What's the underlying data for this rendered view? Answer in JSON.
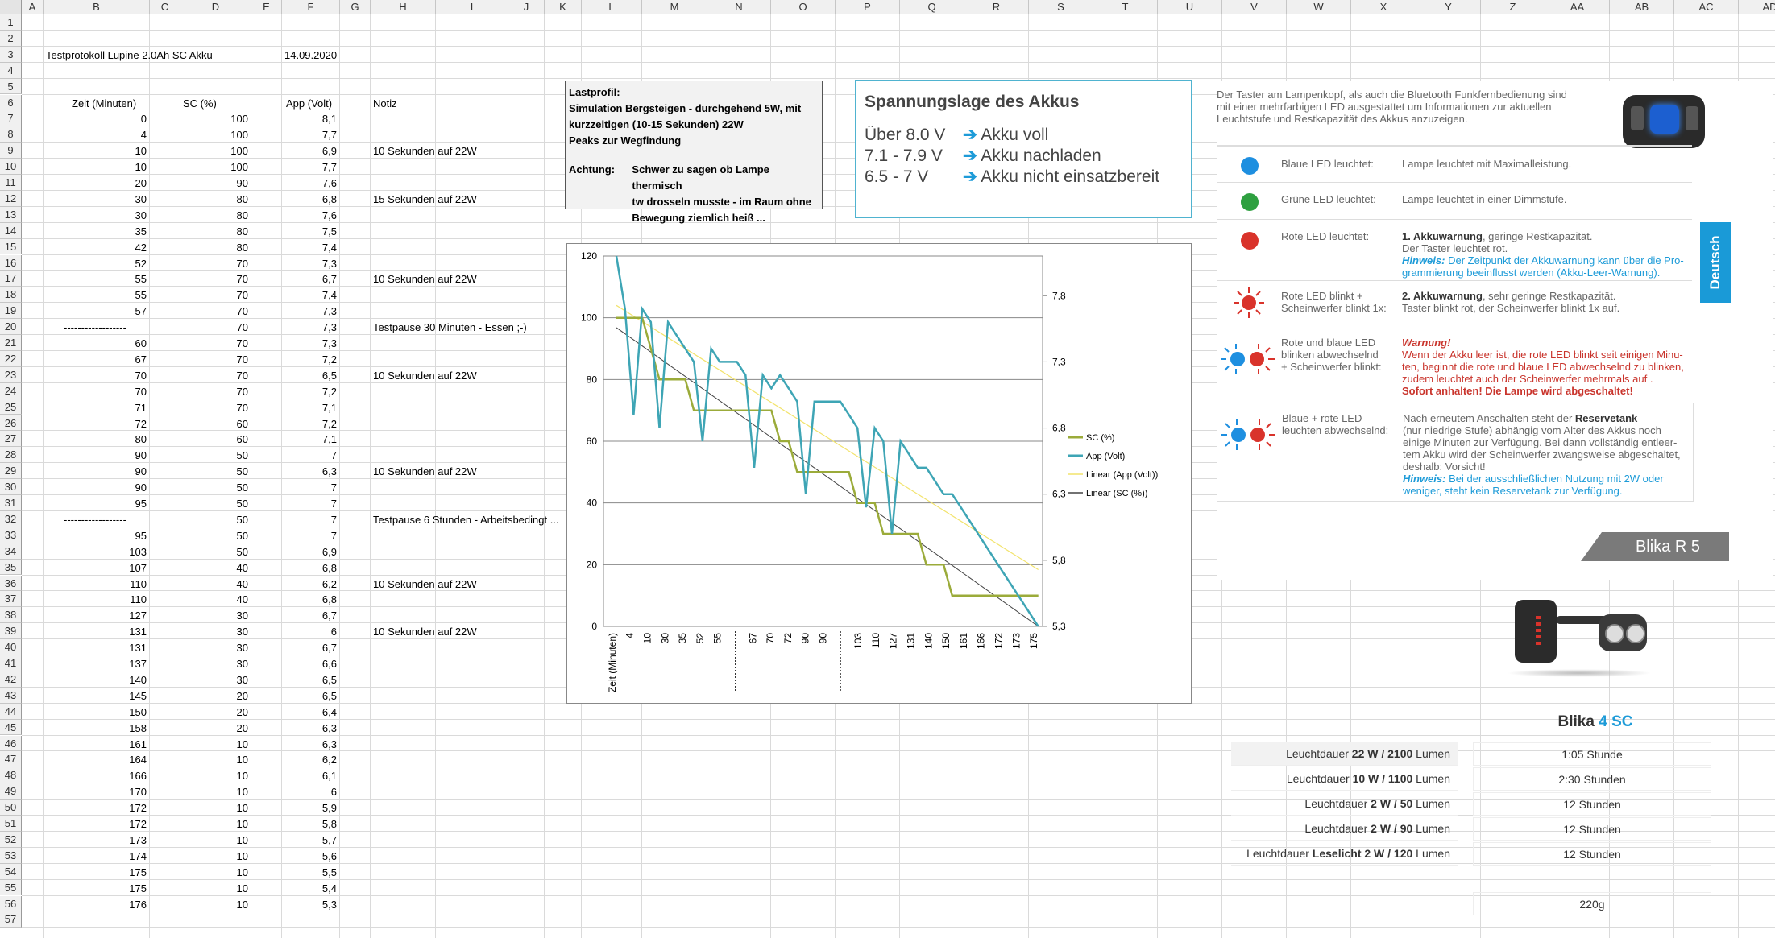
{
  "sheet": {
    "columns": [
      "A",
      "B",
      "C",
      "D",
      "E",
      "F",
      "G",
      "H",
      "I",
      "J",
      "K",
      "L",
      "M",
      "N",
      "O",
      "P",
      "Q",
      "R",
      "S",
      "T",
      "U",
      "V",
      "W",
      "X",
      "Y",
      "Z",
      "AA",
      "AB",
      "AC",
      "AD"
    ],
    "rows": [
      "1",
      "2",
      "3",
      "4",
      "5",
      "6",
      "7",
      "8",
      "9",
      "10",
      "11",
      "12",
      "13",
      "14",
      "15",
      "16",
      "17",
      "18",
      "19",
      "20",
      "21",
      "22",
      "23",
      "24",
      "25",
      "26",
      "27",
      "28",
      "29",
      "30",
      "31",
      "32",
      "33",
      "34",
      "35",
      "36",
      "37",
      "38",
      "39",
      "40",
      "41",
      "42",
      "43",
      "44",
      "45",
      "46",
      "47",
      "48",
      "49",
      "50",
      "51",
      "52",
      "53",
      "54",
      "55",
      "56",
      "57"
    ],
    "title": "Testprotokoll Lupine 2.0Ah SC Akku",
    "date": "14.09.2020",
    "headers": {
      "zeit": "Zeit (Minuten)",
      "sc": "SC (%)",
      "app": "App (Volt)",
      "notiz": "Notiz"
    },
    "data": [
      [
        "0",
        "100",
        "8,1",
        ""
      ],
      [
        "4",
        "100",
        "7,7",
        ""
      ],
      [
        "10",
        "100",
        "6,9",
        "10 Sekunden auf 22W"
      ],
      [
        "10",
        "100",
        "7,7",
        ""
      ],
      [
        "20",
        "90",
        "7,6",
        ""
      ],
      [
        "30",
        "80",
        "6,8",
        "15 Sekunden auf 22W"
      ],
      [
        "30",
        "80",
        "7,6",
        ""
      ],
      [
        "35",
        "80",
        "7,5",
        ""
      ],
      [
        "42",
        "80",
        "7,4",
        ""
      ],
      [
        "52",
        "70",
        "7,3",
        ""
      ],
      [
        "55",
        "70",
        "6,7",
        "10 Sekunden auf 22W"
      ],
      [
        "55",
        "70",
        "7,4",
        ""
      ],
      [
        "57",
        "70",
        "7,3",
        ""
      ],
      [
        "------------------",
        "70",
        "7,3",
        "Testpause 30 Minuten - Essen ;-)"
      ],
      [
        "60",
        "70",
        "7,3",
        ""
      ],
      [
        "67",
        "70",
        "7,2",
        ""
      ],
      [
        "70",
        "70",
        "6,5",
        "10 Sekunden auf 22W"
      ],
      [
        "70",
        "70",
        "7,2",
        ""
      ],
      [
        "71",
        "70",
        "7,1",
        ""
      ],
      [
        "72",
        "60",
        "7,2",
        ""
      ],
      [
        "80",
        "60",
        "7,1",
        ""
      ],
      [
        "90",
        "50",
        "7",
        ""
      ],
      [
        "90",
        "50",
        "6,3",
        "10 Sekunden auf 22W"
      ],
      [
        "90",
        "50",
        "7",
        ""
      ],
      [
        "95",
        "50",
        "7",
        ""
      ],
      [
        "------------------",
        "50",
        "7",
        "Testpause 6 Stunden - Arbeitsbedingt ..."
      ],
      [
        "95",
        "50",
        "7",
        ""
      ],
      [
        "103",
        "50",
        "6,9",
        ""
      ],
      [
        "107",
        "40",
        "6,8",
        ""
      ],
      [
        "110",
        "40",
        "6,2",
        "10 Sekunden auf 22W"
      ],
      [
        "110",
        "40",
        "6,8",
        ""
      ],
      [
        "127",
        "30",
        "6,7",
        ""
      ],
      [
        "131",
        "30",
        "6",
        "10 Sekunden auf 22W"
      ],
      [
        "131",
        "30",
        "6,7",
        ""
      ],
      [
        "137",
        "30",
        "6,6",
        ""
      ],
      [
        "140",
        "30",
        "6,5",
        ""
      ],
      [
        "145",
        "20",
        "6,5",
        ""
      ],
      [
        "150",
        "20",
        "6,4",
        ""
      ],
      [
        "158",
        "20",
        "6,3",
        ""
      ],
      [
        "161",
        "10",
        "6,3",
        ""
      ],
      [
        "164",
        "10",
        "6,2",
        ""
      ],
      [
        "166",
        "10",
        "6,1",
        ""
      ],
      [
        "170",
        "10",
        "6",
        ""
      ],
      [
        "172",
        "10",
        "5,9",
        ""
      ],
      [
        "172",
        "10",
        "5,8",
        ""
      ],
      [
        "173",
        "10",
        "5,7",
        ""
      ],
      [
        "174",
        "10",
        "5,6",
        ""
      ],
      [
        "175",
        "10",
        "5,5",
        ""
      ],
      [
        "175",
        "10",
        "5,4",
        ""
      ],
      [
        "176",
        "10",
        "5,3",
        ""
      ]
    ]
  },
  "lastprofil": {
    "title": "Lastprofil:",
    "line1": "Simulation Bergsteigen - durchgehend 5W, mit",
    "line2": "kurzzeitigen (10-15 Sekunden) 22W",
    "line3": "Peaks zur Wegfindung",
    "achtung_label": "Achtung:",
    "achtung1": "Schwer zu sagen ob Lampe thermisch",
    "achtung2": "tw drosseln musste - im Raum ohne",
    "achtung3": "Bewegung ziemlich heiß ..."
  },
  "spannung": {
    "title": "Spannungslage des Akkus",
    "rows": [
      {
        "range": "Über 8.0 V",
        "arrow": "➔",
        "text": "Akku voll"
      },
      {
        "range": "7.1 - 7.9 V",
        "arrow": "➔",
        "text": "Akku nachladen"
      },
      {
        "range": "6.5 - 7 V",
        "arrow": "➔",
        "text": "Akku nicht einsatzbereit"
      }
    ]
  },
  "info": {
    "intro1": "Der Taster am Lampenkopf, als auch die Bluetooth Funkfernbedienung sind",
    "intro2": "mit einer mehrfarbigen LED ausgestattet um Informationen zur aktuellen",
    "intro3": "Leuchtstufe und Restkapazität des Akkus anzuzeigen.",
    "tab": "Deutsch",
    "rows": [
      {
        "label": "Blaue LED leuchtet:",
        "text1": "Lampe leuchtet mit Maximalleistung."
      },
      {
        "label": "Grüne LED leuchtet:",
        "text1": "Lampe leuchtet in einer Dimmstufe."
      },
      {
        "label": "Rote LED leuchtet:",
        "bold": "1. Akkuwarnung",
        "text1": ", geringe Restkapazität.",
        "text2": "Der Taster leuchtet rot.",
        "hint_label": "Hinweis:",
        "hint1": " Der Zeitpunkt der Akkuwarnung kann über die Pro-",
        "hint2": "grammierung beeinflusst werden (Akku-Leer-Warnung)."
      },
      {
        "label": "Rote LED blinkt +",
        "label2": "Scheinwerfer blinkt 1x:",
        "bold": "2. Akkuwarnung",
        "text1": ", sehr geringe Restkapazität.",
        "text2": "Taster blinkt rot, der Scheinwerfer blinkt 1x auf."
      },
      {
        "label": "Rote  und blaue LED",
        "label2": "blinken abwechselnd",
        "label3": "+ Scheinwerfer blinkt:",
        "warn": "Warnung!",
        "w1": "Wenn der Akku leer ist, die rote LED blinkt seit einigen Minu-",
        "w2": "ten, beginnt die rote und blaue LED abwechselnd zu blinken,",
        "w3": "zudem leuchtet auch der Scheinwerfer mehrmals auf .",
        "w4": "Sofort anhalten! Die Lampe wird abgeschaltet!"
      },
      {
        "label": "Blaue + rote LED",
        "label2": "leuchten abwechselnd:",
        "t1a": "Nach erneutem Anschalten steht der ",
        "t1b": "Reservetank",
        "t2": "(nur niedrige Stufe) abhängig vom Alter des Akkus noch",
        "t3": "einige Minuten zur Verfügung. Bei dann vollständig entleer-",
        "t4": "tem Akku wird der Scheinwerfer zwangsweise abgeschaltet,",
        "t5": "deshalb: Vorsicht!",
        "hint_label": "Hinweis:",
        "hint1": "  Bei der ausschließlichen Nutzung mit 2W oder",
        "hint2": "weniger, steht kein Reservetank zur Verfügung."
      }
    ]
  },
  "product": {
    "banner": "Blika R  5",
    "title_a": "Blika ",
    "title_b": "4 SC",
    "specs": [
      {
        "a": "Leuchtdauer ",
        "b": "22 W / 2100",
        "c": " Lumen",
        "v": "1:05 Stunde"
      },
      {
        "a": "Leuchtdauer ",
        "b": "10 W / 1100",
        "c": " Lumen",
        "v": "2:30 Stunden"
      },
      {
        "a": "Leuchtdauer ",
        "b": "2 W / 50",
        "c": " Lumen",
        "v": "12 Stunden"
      },
      {
        "a": "Leuchtdauer ",
        "b": "2 W / 90",
        "c": " Lumen",
        "v": "12 Stunden"
      },
      {
        "a": "Leuchtdauer ",
        "b": "Leselicht 2 W / 120",
        "c": " Lumen",
        "v": "12 Stunden"
      }
    ],
    "weight": "220g"
  },
  "chart_data": {
    "type": "line",
    "title": "",
    "categories": [
      "Zeit (Minuten)",
      "0",
      "4",
      "10",
      "10",
      "20",
      "30",
      "30",
      "35",
      "42",
      "52",
      "55",
      "55",
      "57",
      "------------------",
      "60",
      "67",
      "70",
      "70",
      "71",
      "72",
      "80",
      "90",
      "90",
      "90",
      "95",
      "------------------",
      "95",
      "103",
      "107",
      "110",
      "110",
      "127",
      "131",
      "131",
      "137",
      "140",
      "145",
      "150",
      "158",
      "161",
      "164",
      "166",
      "170",
      "172",
      "172",
      "173",
      "174",
      "175",
      "175",
      "176"
    ],
    "tick_labels": [
      "Zeit (Minuten)",
      "4",
      "10",
      "30",
      "35",
      "52",
      "55",
      "",
      "67",
      "70",
      "72",
      "90",
      "90",
      "",
      "103",
      "110",
      "127",
      "131",
      "140",
      "150",
      "161",
      "166",
      "172",
      "173",
      "175"
    ],
    "series": [
      {
        "name": "SC (%)",
        "axis": "left",
        "color": "#9bab3a",
        "values": [
          null,
          100,
          100,
          100,
          100,
          90,
          80,
          80,
          80,
          80,
          70,
          70,
          70,
          70,
          70,
          70,
          70,
          70,
          70,
          70,
          60,
          60,
          50,
          50,
          50,
          50,
          50,
          50,
          50,
          40,
          40,
          40,
          30,
          30,
          30,
          30,
          30,
          20,
          20,
          20,
          10,
          10,
          10,
          10,
          10,
          10,
          10,
          10,
          10,
          10,
          10
        ]
      },
      {
        "name": "App (Volt)",
        "axis": "right",
        "color": "#3ea5b5",
        "values": [
          null,
          8.1,
          7.7,
          6.9,
          7.7,
          7.6,
          6.8,
          7.6,
          7.5,
          7.4,
          7.3,
          6.7,
          7.4,
          7.3,
          7.3,
          7.3,
          7.2,
          6.5,
          7.2,
          7.1,
          7.2,
          7.1,
          7,
          6.3,
          7,
          7,
          7,
          7,
          6.9,
          6.8,
          6.2,
          6.8,
          6.7,
          6,
          6.7,
          6.6,
          6.5,
          6.5,
          6.4,
          6.3,
          6.3,
          6.2,
          6.1,
          6,
          5.9,
          5.8,
          5.7,
          5.6,
          5.5,
          5.4,
          5.3
        ]
      },
      {
        "name": "Linear (App (Volt))",
        "axis": "right",
        "color": "#f2e36b",
        "trend_of": "App (Volt)"
      },
      {
        "name": "Linear (SC (%))",
        "axis": "left",
        "color": "#444444",
        "trend_of": "SC (%)"
      }
    ],
    "ylim_left": [
      0,
      120
    ],
    "yticks_left": [
      0,
      20,
      40,
      60,
      80,
      100,
      120
    ],
    "ylim_right": [
      5.3,
      8.1
    ],
    "yticks_right": [
      "5,3",
      "5,8",
      "6,3",
      "6,8",
      "7,3",
      "7,8"
    ],
    "grid": true,
    "legend": "right"
  }
}
